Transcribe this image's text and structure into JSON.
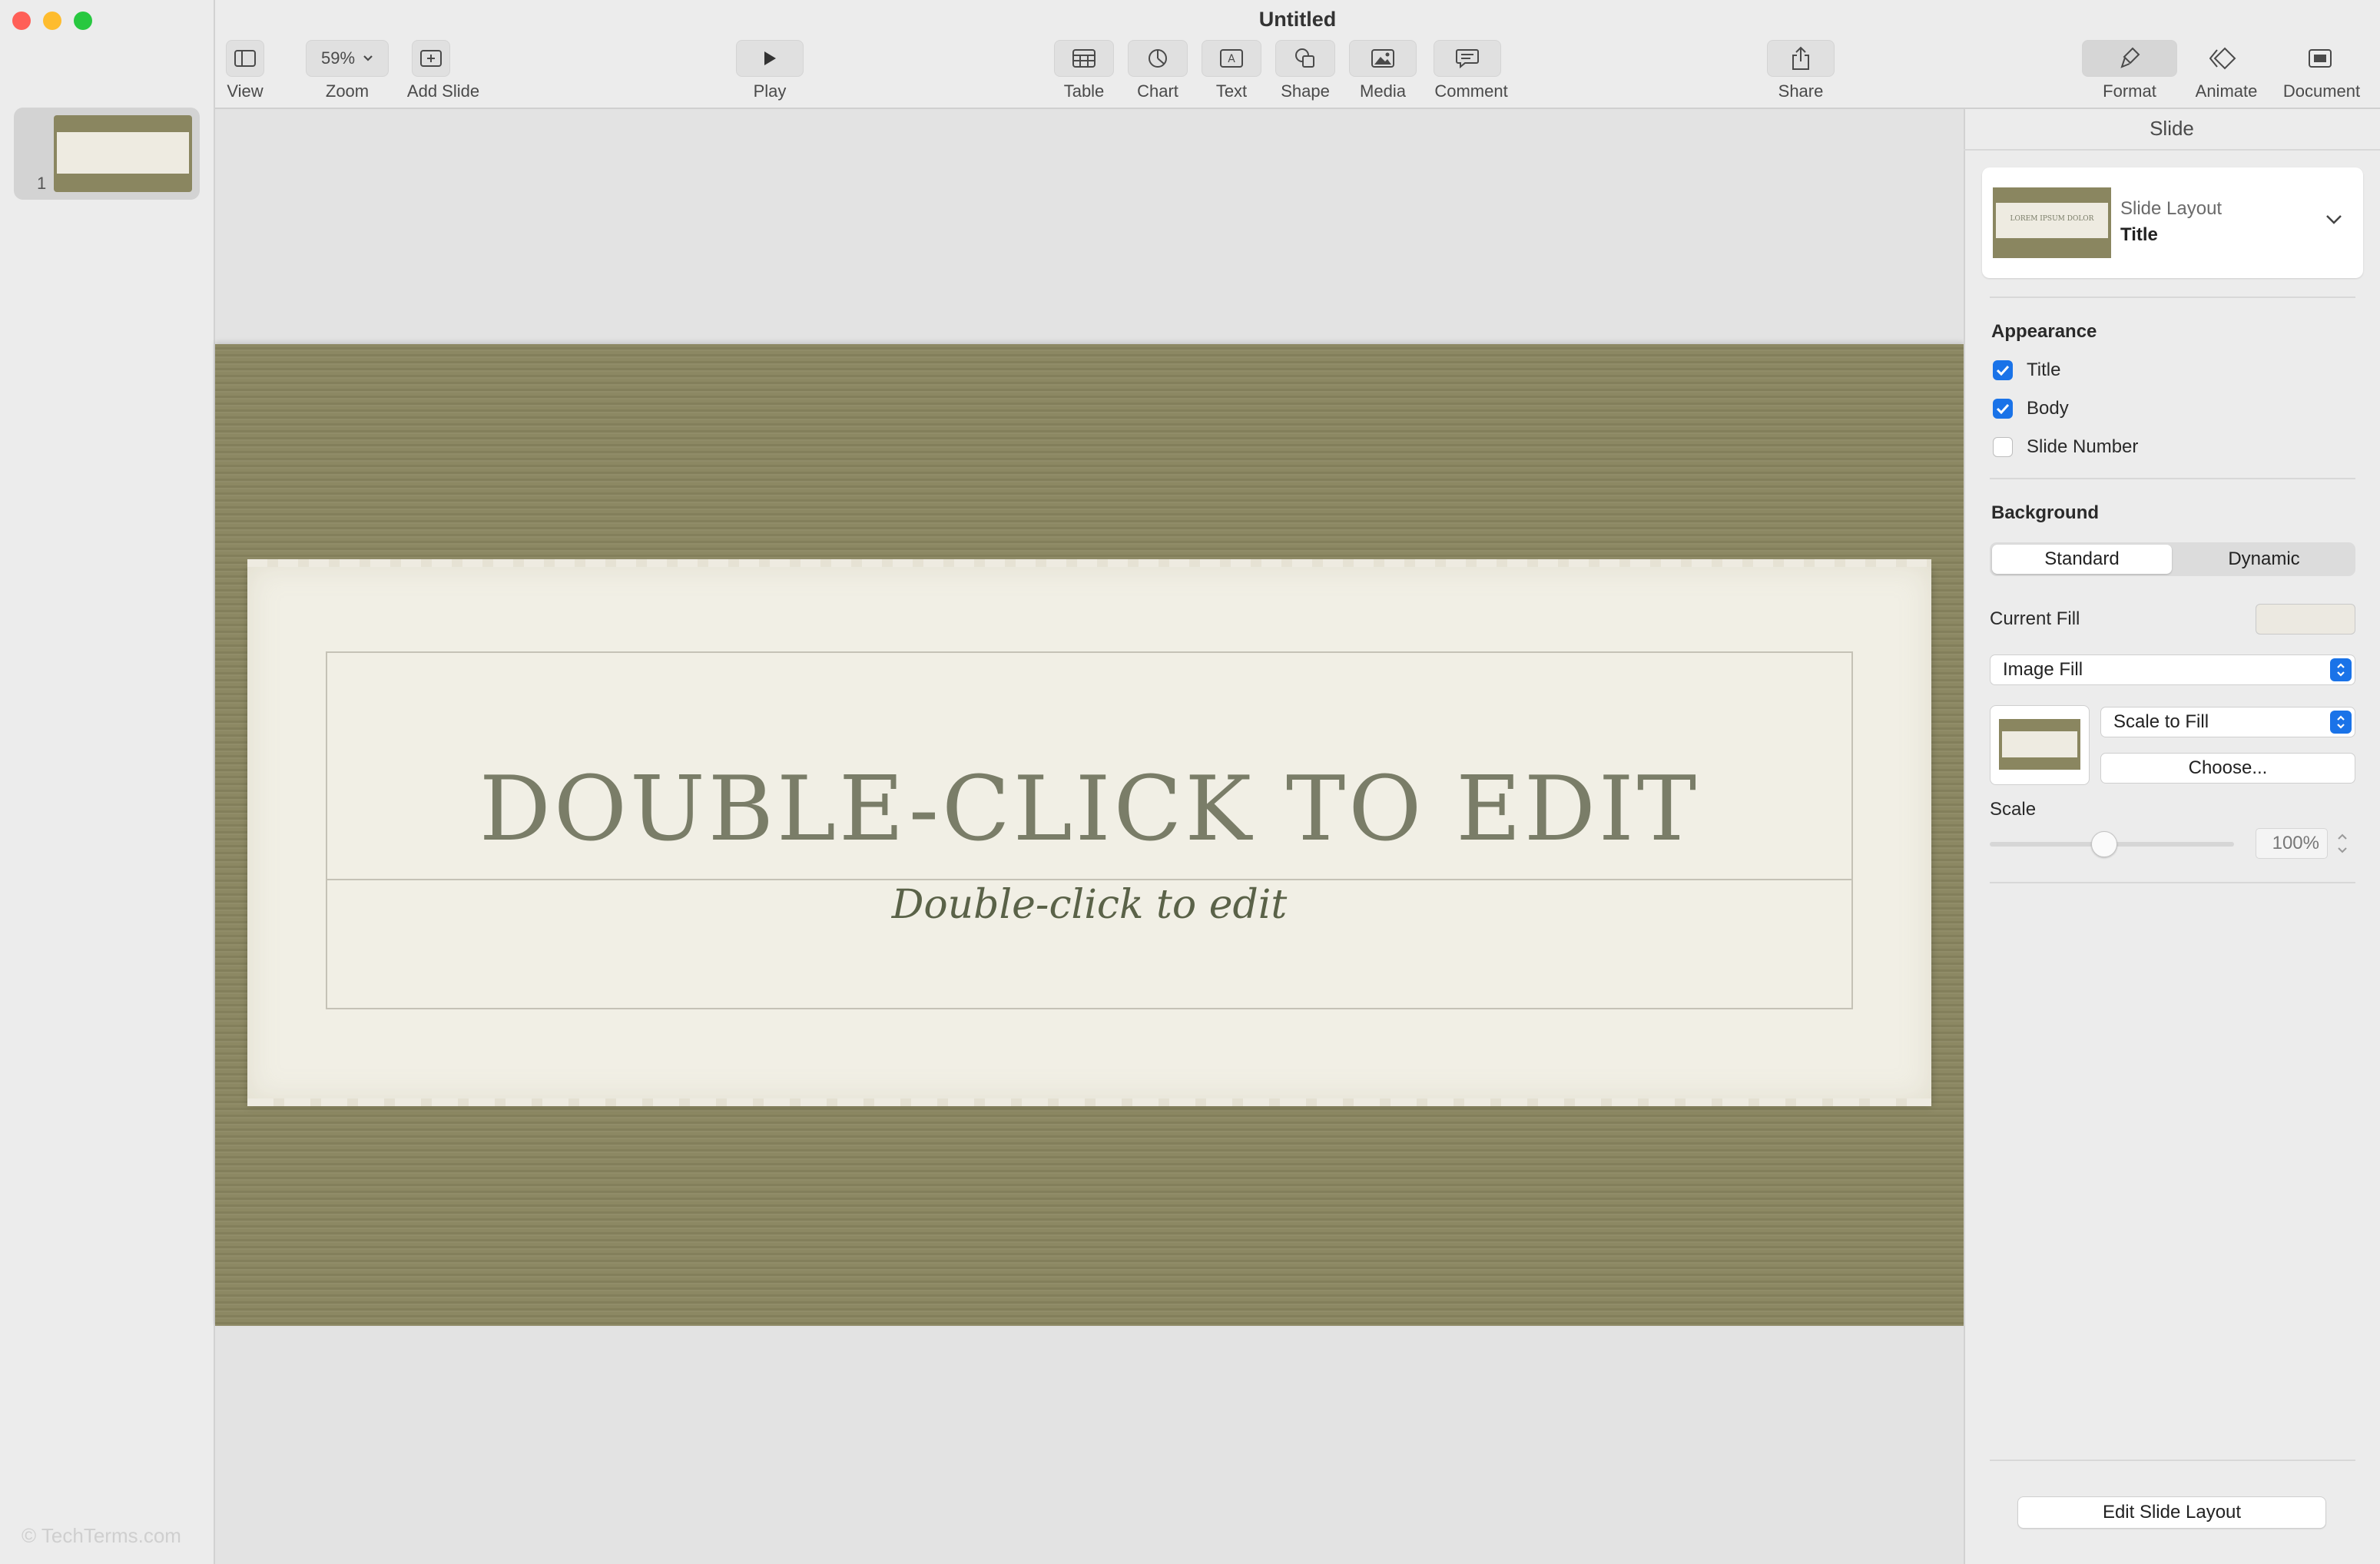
{
  "window": {
    "title": "Untitled"
  },
  "toolbar": {
    "view": "View",
    "zoom": "Zoom",
    "zoom_value": "59%",
    "add_slide": "Add Slide",
    "play": "Play",
    "table": "Table",
    "chart": "Chart",
    "text": "Text",
    "shape": "Shape",
    "media": "Media",
    "comment": "Comment",
    "share": "Share",
    "format": "Format",
    "animate": "Animate",
    "document": "Document"
  },
  "navigator": {
    "slide_number": "1",
    "watermark": "© TechTerms.com"
  },
  "slide": {
    "title": "DOUBLE-CLICK TO EDIT",
    "body": "Double-click to edit"
  },
  "inspector": {
    "title": "Slide",
    "slide_layout_label": "Slide Layout",
    "slide_layout_value": "Title",
    "layout_thumb_text": "LOREM IPSUM DOLOR",
    "appearance": {
      "heading": "Appearance",
      "title": "Title",
      "body": "Body",
      "slide_number": "Slide Number"
    },
    "background": {
      "heading": "Background",
      "standard": "Standard",
      "dynamic": "Dynamic",
      "current_fill": "Current Fill",
      "fill_type": "Image Fill",
      "scale_mode": "Scale to Fill",
      "choose": "Choose...",
      "scale_label": "Scale",
      "scale_value": "100%"
    },
    "edit_layout": "Edit Slide Layout"
  },
  "colors": {
    "slide_background": "#8a8660",
    "paper": "#f1efe5",
    "accent": "#1a73e8"
  }
}
